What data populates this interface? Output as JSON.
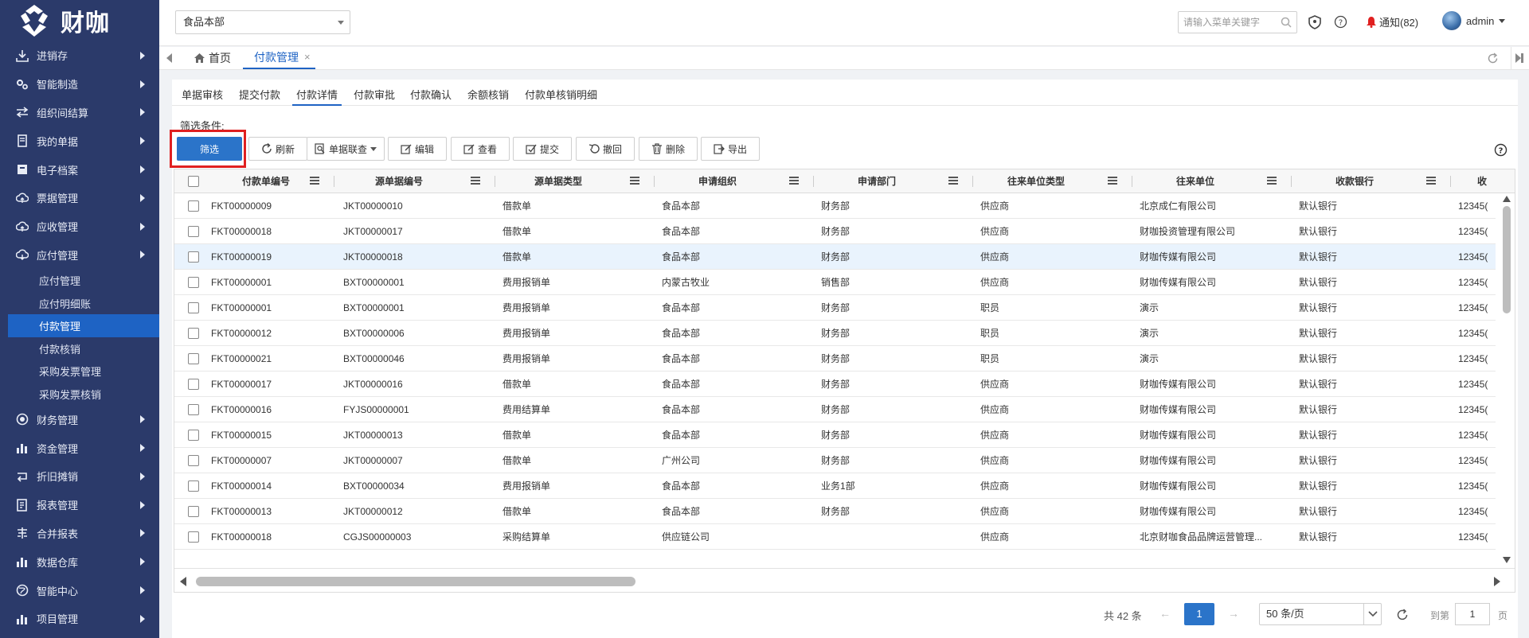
{
  "brand": {
    "logo_text": "财咖"
  },
  "sidebar": {
    "items": [
      {
        "label": "进销存",
        "icon": "download-icon"
      },
      {
        "label": "智能制造",
        "icon": "gears-icon"
      },
      {
        "label": "组织间结算",
        "icon": "exchange-icon"
      },
      {
        "label": "我的单据",
        "icon": "document-icon"
      },
      {
        "label": "电子档案",
        "icon": "archive-icon"
      },
      {
        "label": "票据管理",
        "icon": "cloud-upload-icon"
      },
      {
        "label": "应收管理",
        "icon": "cloud-upload-icon"
      },
      {
        "label": "应付管理",
        "icon": "cloud-download-icon"
      }
    ],
    "sub_items": [
      {
        "label": "应付管理"
      },
      {
        "label": "应付明细账"
      },
      {
        "label": "付款管理",
        "active": true
      },
      {
        "label": "付款核销"
      },
      {
        "label": "采购发票管理"
      },
      {
        "label": "采购发票核销"
      }
    ],
    "items_after": [
      {
        "label": "财务管理",
        "icon": "target-icon"
      },
      {
        "label": "资金管理",
        "icon": "bar-chart-icon"
      },
      {
        "label": "折旧摊销",
        "icon": "loop-icon"
      },
      {
        "label": "报表管理",
        "icon": "report-icon"
      },
      {
        "label": "合并报表",
        "icon": "merge-icon"
      },
      {
        "label": "数据仓库",
        "icon": "bar-chart-icon"
      },
      {
        "label": "智能中心",
        "icon": "globe-icon"
      },
      {
        "label": "项目管理",
        "icon": "bar-chart-icon"
      }
    ]
  },
  "topbar": {
    "org_selected": "食品本部",
    "search_placeholder": "请输入菜单关键字",
    "notify_label": "通知(82)",
    "user_name": "admin"
  },
  "tabs": {
    "home": "首页",
    "current": "付款管理"
  },
  "subtabs": [
    "单据审核",
    "提交付款",
    "付款详情",
    "付款审批",
    "付款确认",
    "余额核销",
    "付款单核销明细"
  ],
  "subtab_active": "付款详情",
  "filter_label": "筛选条件:",
  "toolbar": {
    "filter": "筛选",
    "refresh": "刷新",
    "linked_query": "单据联查",
    "edit": "编辑",
    "view": "查看",
    "submit": "提交",
    "revoke": "撤回",
    "delete": "删除",
    "export": "导出"
  },
  "table": {
    "columns": [
      "付款单编号",
      "源单据编号",
      "源单据类型",
      "申请组织",
      "申请部门",
      "往来单位类型",
      "往来单位",
      "收款银行",
      "收"
    ],
    "rows": [
      [
        "FKT00000009",
        "JKT00000010",
        "借款单",
        "食品本部",
        "财务部",
        "供应商",
        "北京成仁有限公司",
        "默认银行",
        "12345("
      ],
      [
        "FKT00000018",
        "JKT00000017",
        "借款单",
        "食品本部",
        "财务部",
        "供应商",
        "财咖投资管理有限公司",
        "默认银行",
        "12345("
      ],
      [
        "FKT00000019",
        "JKT00000018",
        "借款单",
        "食品本部",
        "财务部",
        "供应商",
        "财咖传媒有限公司",
        "默认银行",
        "12345("
      ],
      [
        "FKT00000001",
        "BXT00000001",
        "费用报销单",
        "内蒙古牧业",
        "销售部",
        "供应商",
        "财咖传媒有限公司",
        "默认银行",
        "12345("
      ],
      [
        "FKT00000001",
        "BXT00000001",
        "费用报销单",
        "食品本部",
        "财务部",
        "职员",
        "演示",
        "默认银行",
        "12345("
      ],
      [
        "FKT00000012",
        "BXT00000006",
        "费用报销单",
        "食品本部",
        "财务部",
        "职员",
        "演示",
        "默认银行",
        "12345("
      ],
      [
        "FKT00000021",
        "BXT00000046",
        "费用报销单",
        "食品本部",
        "财务部",
        "职员",
        "演示",
        "默认银行",
        "12345("
      ],
      [
        "FKT00000017",
        "JKT00000016",
        "借款单",
        "食品本部",
        "财务部",
        "供应商",
        "财咖传媒有限公司",
        "默认银行",
        "12345("
      ],
      [
        "FKT00000016",
        "FYJS00000001",
        "费用结算单",
        "食品本部",
        "财务部",
        "供应商",
        "财咖传媒有限公司",
        "默认银行",
        "12345("
      ],
      [
        "FKT00000015",
        "JKT00000013",
        "借款单",
        "食品本部",
        "财务部",
        "供应商",
        "财咖传媒有限公司",
        "默认银行",
        "12345("
      ],
      [
        "FKT00000007",
        "JKT00000007",
        "借款单",
        "广州公司",
        "财务部",
        "供应商",
        "财咖传媒有限公司",
        "默认银行",
        "12345("
      ],
      [
        "FKT00000014",
        "BXT00000034",
        "费用报销单",
        "食品本部",
        "业务1部",
        "供应商",
        "财咖传媒有限公司",
        "默认银行",
        "12345("
      ],
      [
        "FKT00000013",
        "JKT00000012",
        "借款单",
        "食品本部",
        "财务部",
        "供应商",
        "财咖传媒有限公司",
        "默认银行",
        "12345("
      ],
      [
        "FKT00000018",
        "CGJS00000003",
        "采购结算单",
        "供应链公司",
        "",
        "供应商",
        "北京财咖食品品牌运营管理...",
        "默认银行",
        "12345("
      ]
    ],
    "selected_row": 2
  },
  "pager": {
    "total": "共 42 条",
    "current_page": "1",
    "page_size": "50 条/页",
    "goto_label": "到第",
    "goto_value": "1",
    "page_suffix": "页"
  },
  "colors": {
    "sidebar_bg": "#2b3a6a",
    "accent": "#1e63c4",
    "highlight_box": "#e02020",
    "selected_row": "#e9f3fd"
  }
}
